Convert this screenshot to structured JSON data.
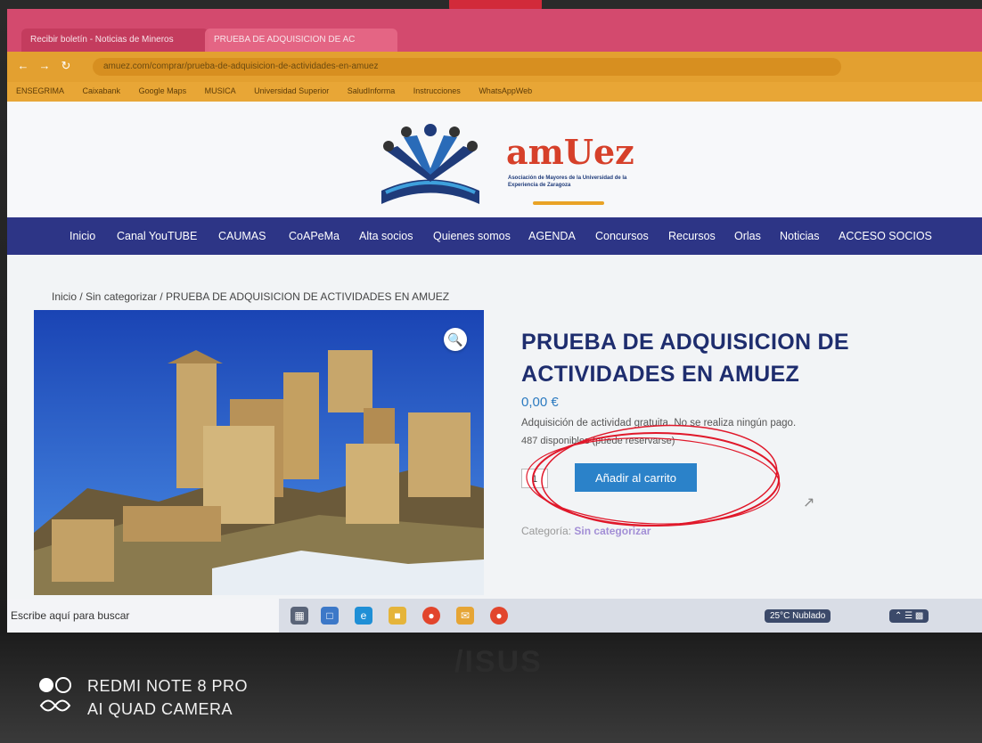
{
  "browser": {
    "tabs": [
      "Recibir boletín - Noticias de Mineros",
      "PRUEBA DE ADQUISICION DE AC"
    ],
    "url": "amuez.com/comprar/prueba-de-adquisicion-de-actividades-en-amuez",
    "bookmarks": [
      "ENSEGRIMA",
      "Caixabank",
      "Google Maps",
      "MUSICA",
      "Universidad Superior",
      "SaludInforma",
      "Instrucciones",
      "WhatsAppWeb"
    ]
  },
  "site": {
    "logo_title_prefix": "am",
    "logo_title_accent": "Uez",
    "logo_subtitle": "Asociación de Mayores de la Universidad de la Experiencia de Zaragoza",
    "nav": [
      "Inicio",
      "Canal YouTUBE",
      "CAUMAS",
      "CoAPeMa",
      "Alta socios",
      "Quienes somos",
      "AGENDA",
      "Concursos",
      "Recursos",
      "Orlas",
      "Noticias",
      "ACCESO SOCIOS"
    ]
  },
  "product": {
    "breadcrumb": "Inicio / Sin categorizar / PRUEBA DE ADQUISICION DE ACTIVIDADES EN AMUEZ",
    "title": "PRUEBA DE ADQUISICION DE ACTIVIDADES EN AMUEZ",
    "price": "0,00 €",
    "description": "Adquisición de actividad gratuita. No se realiza ningún pago.",
    "stock": "487 disponibles (puede reservarse)",
    "quantity": "1",
    "add_to_cart_label": "Añadir al carrito",
    "category_label": "Categoría:",
    "category_value": "Sin categorizar"
  },
  "taskbar": {
    "search_placeholder": "Escribe aquí para buscar",
    "weather": "25°C Nublado"
  },
  "photo_watermark": {
    "line1": "REDMI NOTE 8 PRO",
    "line2": "AI QUAD CAMERA"
  },
  "laptop_brand": "/ISUS",
  "colors": {
    "nav_bg": "#2d3586",
    "title": "#1e2d6e",
    "button": "#2b82c9",
    "annotation": "#e0182a"
  }
}
